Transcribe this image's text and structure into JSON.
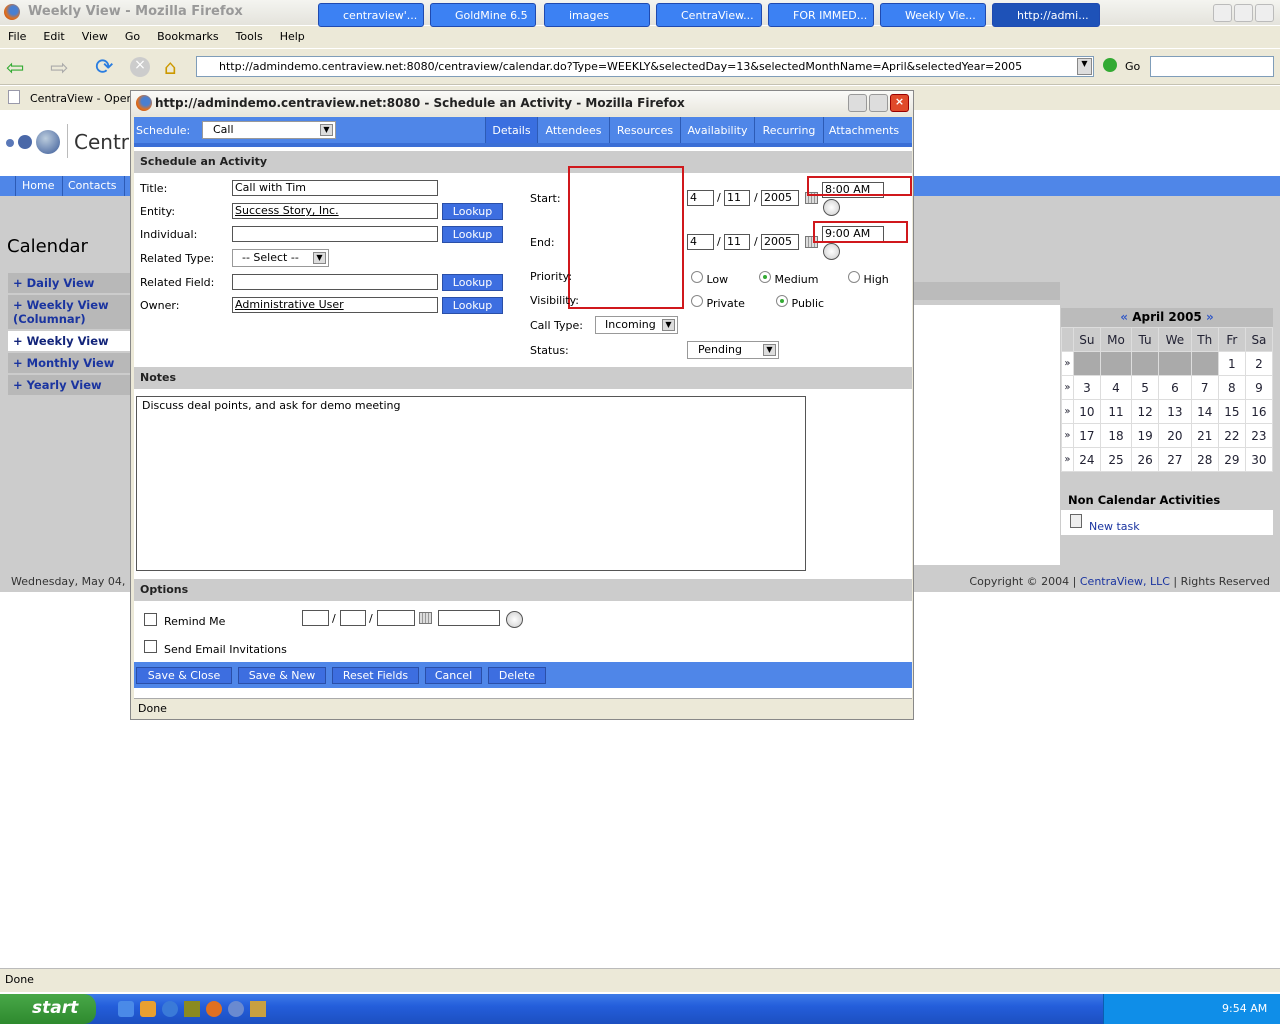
{
  "browser": {
    "title": "Weekly View - Mozilla Firefox",
    "menu": [
      "File",
      "Edit",
      "View",
      "Go",
      "Bookmarks",
      "Tools",
      "Help"
    ],
    "url": "http://admindemo.centraview.net:8080/centraview/calendar.do?Type=WEEKLY&selectedDay=13&selectedMonthName=April&selectedYear=2005",
    "go": "Go",
    "tab": "CentraView - Open ...",
    "status": "Done"
  },
  "page": {
    "logo": "Centra",
    "nav": [
      "Home",
      "Contacts"
    ],
    "heading": "Calendar",
    "side": [
      "+ Daily View",
      "+ Weekly View (Columnar)",
      "+ Weekly View",
      "+ Monthly View",
      "+ Yearly View"
    ],
    "footer_date": "Wednesday, May 04,",
    "copyright": "Copyright © 2004 |",
    "company": "CentraView, LLC",
    "rights": "| Rights Reserved",
    "minical": {
      "title": "April 2005",
      "prev": "«",
      "next": "»",
      "days": [
        "Su",
        "Mo",
        "Tu",
        "We",
        "Th",
        "Fr",
        "Sa"
      ],
      "weeks": [
        [
          "",
          "",
          "",
          "",
          "",
          "1",
          "2"
        ],
        [
          "3",
          "4",
          "5",
          "6",
          "7",
          "8",
          "9"
        ],
        [
          "10",
          "11",
          "12",
          "13",
          "14",
          "15",
          "16"
        ],
        [
          "17",
          "18",
          "19",
          "20",
          "21",
          "22",
          "23"
        ],
        [
          "24",
          "25",
          "26",
          "27",
          "28",
          "29",
          "30"
        ]
      ],
      "rowmark": "»"
    },
    "noncal": {
      "title": "Non Calendar Activities",
      "item": "New task"
    }
  },
  "popup": {
    "title": "http://admindemo.centraview.net:8080 - Schedule an Activity - Mozilla Firefox",
    "schedule_label": "Schedule:",
    "schedule_value": "Call",
    "tabs": [
      "Details",
      "Attendees",
      "Resources",
      "Availability",
      "Recurring",
      "Attachments"
    ],
    "active_tab": "Details",
    "section": "Schedule an Activity",
    "fields": {
      "title_l": "Title:",
      "title_v": "Call with Tim",
      "entity_l": "Entity:",
      "entity_v": "Success Story, Inc.",
      "individual_l": "Individual:",
      "individual_v": "",
      "reltype_l": "Related Type:",
      "reltype_v": "-- Select --",
      "relfield_l": "Related Field:",
      "relfield_v": "",
      "owner_l": "Owner:",
      "owner_v": "Administrative User",
      "lookup": "Lookup"
    },
    "start_l": "Start:",
    "start": {
      "m": "4",
      "d": "11",
      "y": "2005",
      "t": "8:00 AM"
    },
    "end_l": "End:",
    "end": {
      "m": "4",
      "d": "11",
      "y": "2005",
      "t": "9:00 AM"
    },
    "sep": "/",
    "priority_l": "Priority:",
    "priority": [
      "Low",
      "Medium",
      "High"
    ],
    "priority_selected": "Medium",
    "visibility_l": "Visibility:",
    "visibility": [
      "Private",
      "Public"
    ],
    "visibility_selected": "Public",
    "calltype_l": "Call Type:",
    "calltype_v": "Incoming",
    "status_l": "Status:",
    "status_v": "Pending",
    "notes_h": "Notes",
    "notes": "Discuss deal points, and ask for demo meeting",
    "options_h": "Options",
    "remind": "Remind Me",
    "email": "Send Email Invitations",
    "buttons": [
      "Save & Close",
      "Save & New",
      "Reset Fields",
      "Cancel",
      "Delete"
    ],
    "status": "Done"
  },
  "taskbar": {
    "start": "start",
    "items": [
      "centraview'...",
      "GoldMine 6.5",
      "images",
      "CentraView...",
      "FOR IMMED...",
      "Weekly Vie...",
      "http://admi..."
    ],
    "clock": "9:54 AM"
  }
}
